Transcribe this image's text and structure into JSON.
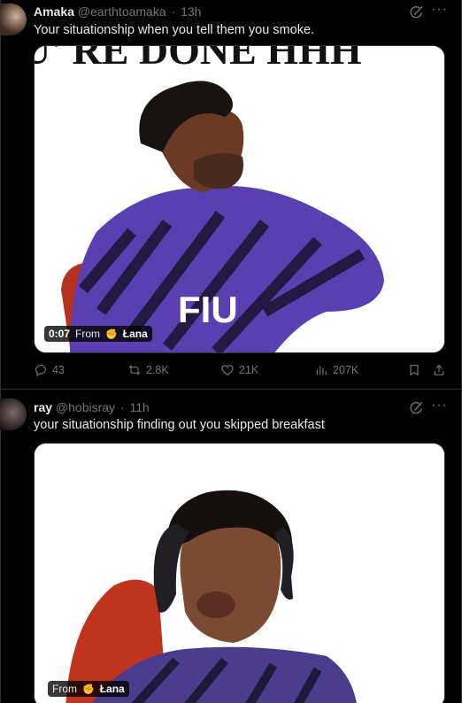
{
  "tweets": [
    {
      "name": "Amaka",
      "handle": "@earthtoamaka",
      "time": "13h",
      "text": "Your situationship when you tell them you smoke.",
      "media": {
        "caption_text": "U' RE DONE HHH",
        "shirt_text": "FIU",
        "duration": "0:07",
        "from_label": "From",
        "source_author": "Łana"
      },
      "stats": {
        "replies": "43",
        "reposts": "2.8K",
        "likes": "21K",
        "views": "207K"
      }
    },
    {
      "name": "ray",
      "handle": "@hobisray",
      "time": "11h",
      "text": "your situationship finding out you skipped breakfast",
      "media": {
        "from_label": "From",
        "source_author": "Łana"
      }
    }
  ],
  "icons": {
    "grok": "grok-icon",
    "more": "more-icon",
    "reply": "reply-icon",
    "repost": "repost-icon",
    "like": "like-icon",
    "views": "views-icon",
    "bookmark": "bookmark-icon",
    "share": "share-icon"
  },
  "colors": {
    "background": "#000000",
    "text_primary": "#e7e9ea",
    "text_secondary": "#71767b",
    "border": "#2f3336",
    "shirt_purple": "#5a3fb0"
  }
}
